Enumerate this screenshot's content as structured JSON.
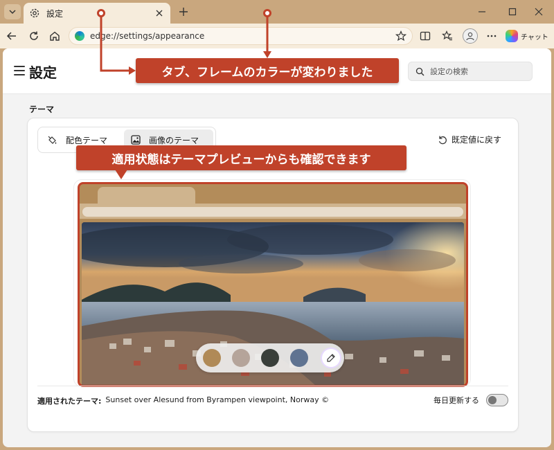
{
  "browser": {
    "tab_title": "設定",
    "address": "edge://settings/appearance",
    "chat_label": "チャット"
  },
  "header": {
    "title": "設定",
    "search_placeholder": "設定の検索"
  },
  "theme": {
    "section_title": "テーマ",
    "segments": [
      {
        "label": "配色テーマ",
        "selected": false
      },
      {
        "label": "画像のテーマ",
        "selected": true
      }
    ],
    "reset_label": "既定値に戻す",
    "swatch_colors": [
      "#b08a57",
      "#b5a49a",
      "#3a3f3a",
      "#5f7391"
    ],
    "applied_label": "適用されたテーマ:",
    "applied_value": "Sunset over Alesund from Byrampen viewpoint, Norway ©",
    "daily_update_label": "毎日更新する",
    "daily_update_on": false
  },
  "annotations": {
    "callout_1": "タブ、フレームのカラーが変わりました",
    "callout_2": "適用状態はテーマプレビューからも確認できます"
  },
  "colors": {
    "frame": "#c9a77e",
    "toolbar": "#f6ecdc",
    "accent": "#c0422a"
  }
}
